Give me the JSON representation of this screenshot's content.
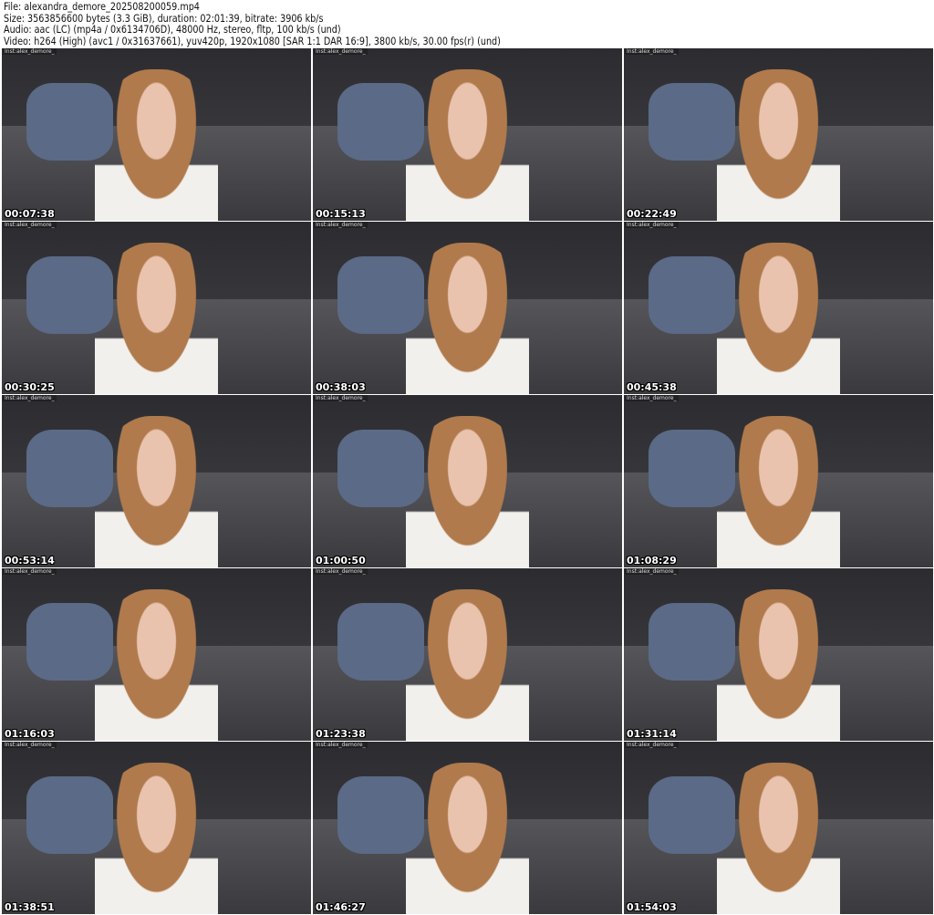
{
  "header": {
    "file": "File: alexandra_demore_202508200059.mp4",
    "size": "Size: 3563856600 bytes (3.3 GiB), duration: 02:01:39, bitrate: 3906 kb/s",
    "audio": "Audio: aac (LC) (mp4a / 0x6134706D), 48000 Hz, stereo, fltp, 100 kb/s (und)",
    "video": "Video: h264 (High) (avc1 / 0x31637661), yuv420p, 1920x1080 [SAR 1:1 DAR 16:9], 3800 kb/s, 30.00 fps(r) (und)"
  },
  "watermark": "Inst:alex_demore_",
  "thumbnails": [
    {
      "time": "00:07:38"
    },
    {
      "time": "00:15:13"
    },
    {
      "time": "00:22:49"
    },
    {
      "time": "00:30:25"
    },
    {
      "time": "00:38:03"
    },
    {
      "time": "00:45:38"
    },
    {
      "time": "00:53:14"
    },
    {
      "time": "01:00:50"
    },
    {
      "time": "01:08:29"
    },
    {
      "time": "01:16:03"
    },
    {
      "time": "01:23:38"
    },
    {
      "time": "01:31:14"
    },
    {
      "time": "01:38:51"
    },
    {
      "time": "01:46:27"
    },
    {
      "time": "01:54:03"
    }
  ]
}
